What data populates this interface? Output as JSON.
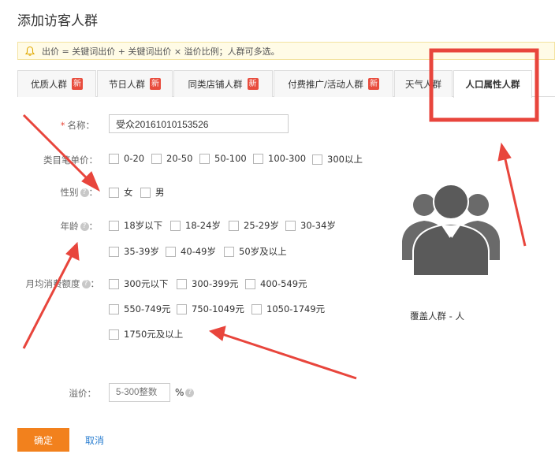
{
  "title": "添加访客人群",
  "notice": "出价 = 关键词出价 + 关键词出价 × 溢价比例；人群可多选。",
  "tabs": [
    {
      "label": "优质人群",
      "badge": "新"
    },
    {
      "label": "节日人群",
      "badge": "新"
    },
    {
      "label": "同类店铺人群",
      "badge": "新"
    },
    {
      "label": "付费推广/活动人群",
      "badge": "新"
    },
    {
      "label": "天气人群",
      "badge": ""
    },
    {
      "label": "人口属性人群",
      "badge": ""
    }
  ],
  "active_tab": "人口属性人群",
  "form": {
    "name_label": "名称：",
    "name_value": "受众20161010153526",
    "category_label": "类目笔单价：",
    "category_options": [
      "0-20",
      "20-50",
      "50-100",
      "100-300",
      "300以上"
    ],
    "gender_label": "性别",
    "gender_options": [
      "女",
      "男"
    ],
    "age_label": "年龄",
    "age_options_row1": [
      "18岁以下",
      "18-24岁",
      "25-29岁",
      "30-34岁"
    ],
    "age_options_row2": [
      "35-39岁",
      "40-49岁",
      "50岁及以上"
    ],
    "spend_label": "月均消费额度",
    "spend_options_row1": [
      "300元以下",
      "300-399元",
      "400-549元"
    ],
    "spend_options_row2": [
      "550-749元",
      "750-1049元",
      "1050-1749元"
    ],
    "spend_options_row3": [
      "1750元及以上"
    ],
    "premium_label": "溢价：",
    "premium_placeholder": "5-300整数",
    "premium_unit": "%",
    "colon": "："
  },
  "coverage": "覆盖人群 - 人",
  "buttons": {
    "ok": "确定",
    "cancel": "取消"
  },
  "colors": {
    "accent": "#f2811d",
    "badge": "#e84c3d",
    "link": "#2c7fd1",
    "annotation": "#e8453c"
  }
}
